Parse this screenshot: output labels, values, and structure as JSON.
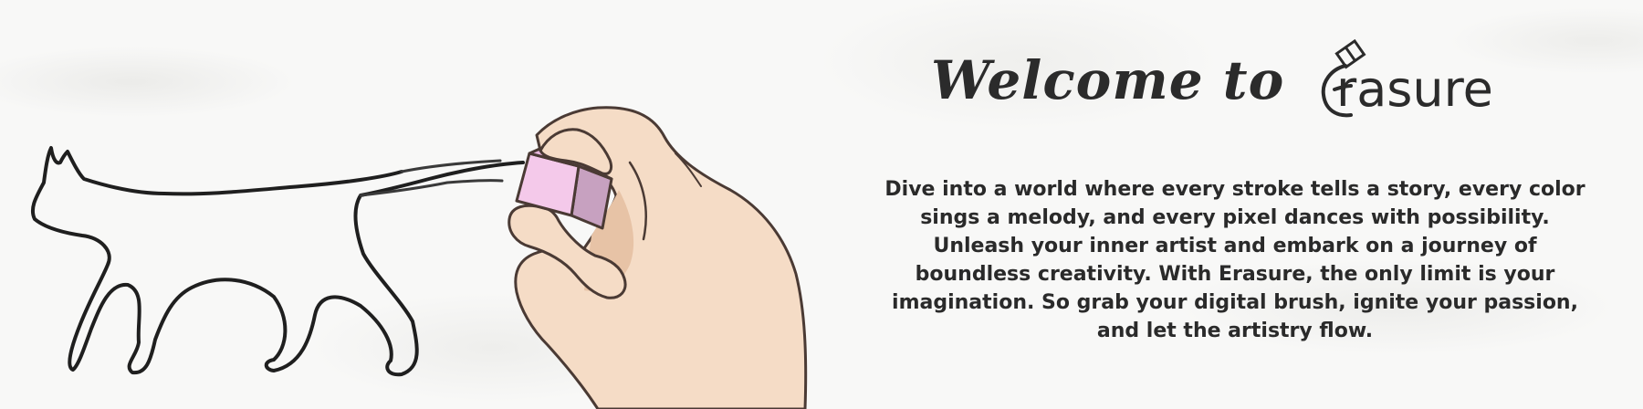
{
  "hero": {
    "welcome_prefix": "Welcome to",
    "brand_name": "rasure",
    "brand_logo": "eraser-e-logo",
    "description": "Dive into a world where every stroke tells a story, every color sings a melody, and every pixel dances with possibility. Unleash your inner artist and embark on a journey of boundless creativity. With Erasure, the only limit is your imagination. So grab your digital brush, ignite your passion, and let the artistry flow."
  },
  "illustration": {
    "subject": "hand-erasing-cat-drawing",
    "colors": {
      "skin": "#f5dcc6",
      "skin_shadow": "#e7c3a6",
      "outline": "#4a3a34",
      "eraser_front": "#f4c9ea",
      "eraser_side": "#c7a1c0",
      "sketch": "#1f1f1f"
    }
  }
}
